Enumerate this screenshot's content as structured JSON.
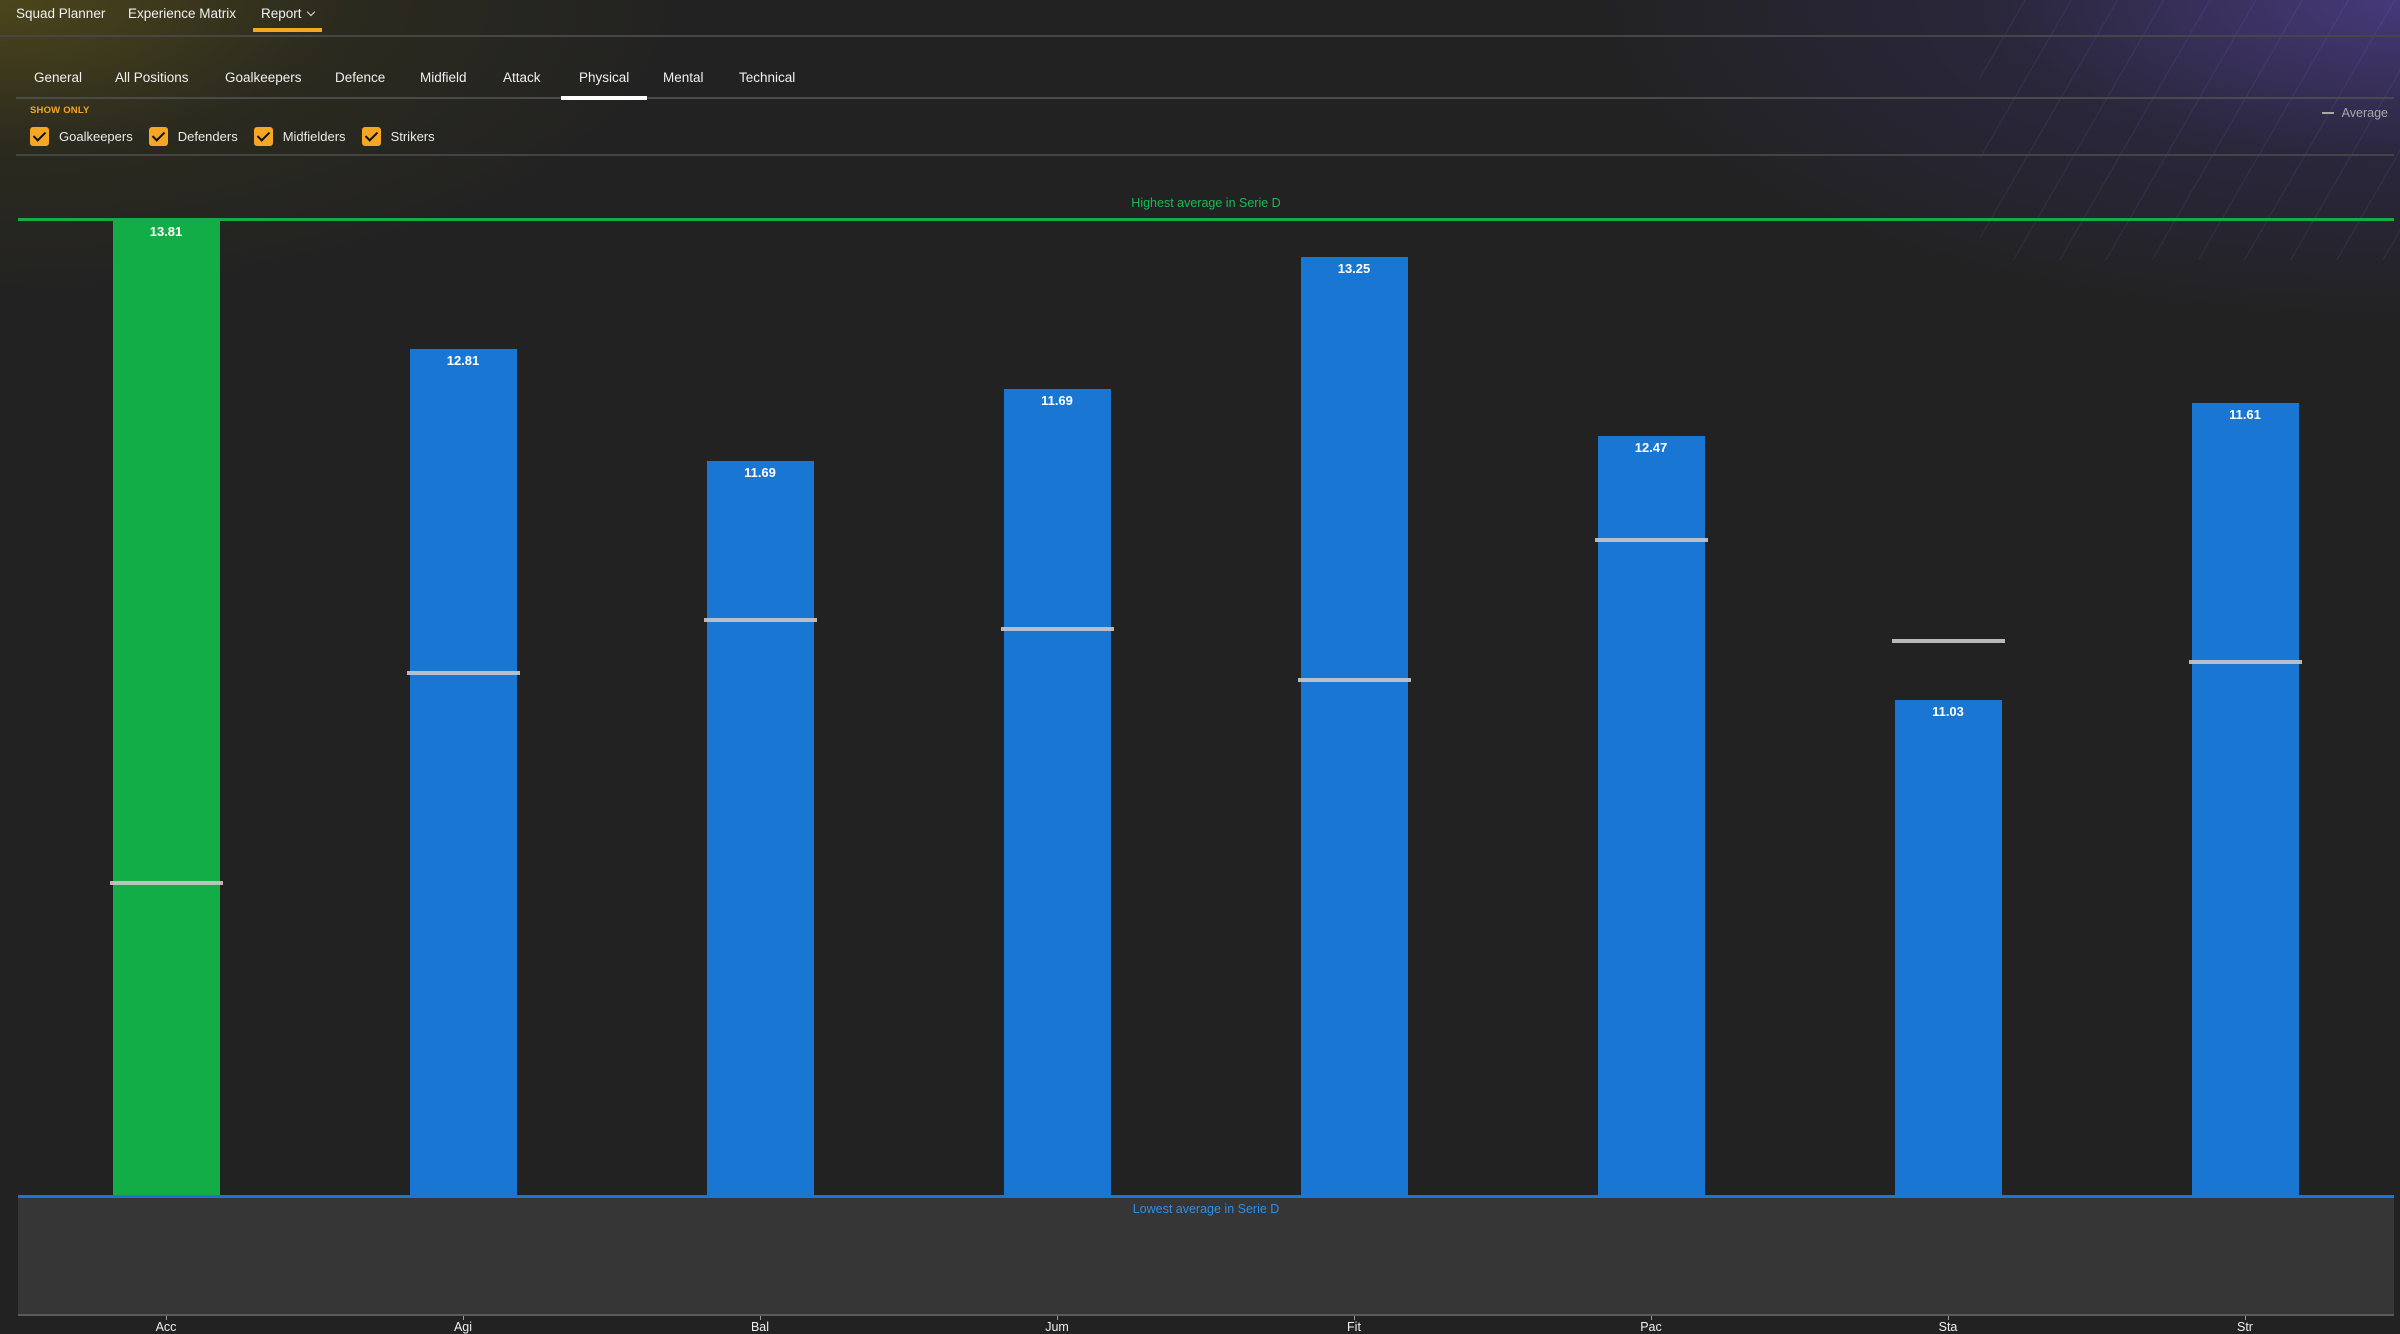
{
  "topnav": {
    "items": [
      {
        "label": "Squad Planner",
        "active": false
      },
      {
        "label": "Experience Matrix",
        "active": false
      },
      {
        "label": "Report",
        "active": true,
        "has_dropdown": true
      }
    ]
  },
  "tabs": [
    {
      "label": "General",
      "active": false
    },
    {
      "label": "All Positions",
      "active": false
    },
    {
      "label": "Goalkeepers",
      "active": false
    },
    {
      "label": "Defence",
      "active": false
    },
    {
      "label": "Midfield",
      "active": false
    },
    {
      "label": "Attack",
      "active": false
    },
    {
      "label": "Physical",
      "active": true
    },
    {
      "label": "Mental",
      "active": false
    },
    {
      "label": "Technical",
      "active": false
    }
  ],
  "filters": {
    "heading": "SHOW ONLY",
    "options": [
      {
        "label": "Goalkeepers",
        "checked": true
      },
      {
        "label": "Defenders",
        "checked": true
      },
      {
        "label": "Midfielders",
        "checked": true
      },
      {
        "label": "Strikers",
        "checked": true
      }
    ]
  },
  "legend": {
    "average_label": "Average"
  },
  "colors": {
    "accent": "#f5a623",
    "highest": "#13ad47",
    "bar": "#1976d2",
    "average_marker": "#c9c9c9"
  },
  "chart_data": {
    "type": "bar",
    "title": "",
    "upper_reference_label": "Highest average in Serie D",
    "lower_reference_label": "Lowest average in Serie D",
    "categories": [
      "Acc",
      "Agi",
      "Bal",
      "Jum",
      "Fit",
      "Pac",
      "Sta",
      "Str"
    ],
    "values": [
      13.81,
      12.81,
      11.69,
      11.69,
      13.25,
      12.47,
      11.03,
      11.61
    ],
    "value_position_between_lowest_and_highest": [
      1.0,
      0.868,
      0.753,
      0.827,
      0.962,
      0.779,
      0.508,
      0.812
    ],
    "average_position_between_lowest_and_highest": [
      0.321,
      0.536,
      0.59,
      0.581,
      0.529,
      0.672,
      0.569,
      0.547
    ],
    "highlight": [
      true,
      false,
      false,
      false,
      false,
      false,
      false,
      false
    ],
    "xlabel": "",
    "ylabel": "",
    "grid": false,
    "legend": "top-right"
  }
}
